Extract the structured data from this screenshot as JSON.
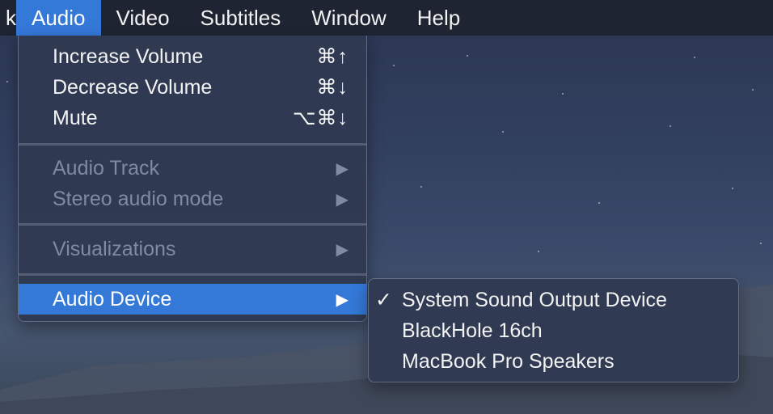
{
  "menubar": {
    "cut_item": "k",
    "items": [
      {
        "label": "Audio",
        "active": true
      },
      {
        "label": "Video"
      },
      {
        "label": "Subtitles"
      },
      {
        "label": "Window"
      },
      {
        "label": "Help"
      }
    ]
  },
  "audio_menu": {
    "increase_volume": {
      "label": "Increase Volume",
      "shortcut": "⌘↑"
    },
    "decrease_volume": {
      "label": "Decrease Volume",
      "shortcut": "⌘↓"
    },
    "mute": {
      "label": "Mute",
      "shortcut": "⌥⌘↓"
    },
    "audio_track": {
      "label": "Audio Track",
      "arrow": "▶"
    },
    "stereo_mode": {
      "label": "Stereo audio mode",
      "arrow": "▶"
    },
    "visualizations": {
      "label": "Visualizations",
      "arrow": "▶"
    },
    "audio_device": {
      "label": "Audio Device",
      "arrow": "▶"
    }
  },
  "audio_device_submenu": {
    "check": "✓",
    "items": [
      {
        "label": "System Sound Output Device",
        "checked": true
      },
      {
        "label": "BlackHole 16ch"
      },
      {
        "label": "MacBook Pro Speakers"
      }
    ]
  },
  "colors": {
    "accent": "#3478d8",
    "menubar_bg": "#1f2433",
    "menu_bg": "#303a52",
    "disabled_text": "#7f8ba3"
  }
}
